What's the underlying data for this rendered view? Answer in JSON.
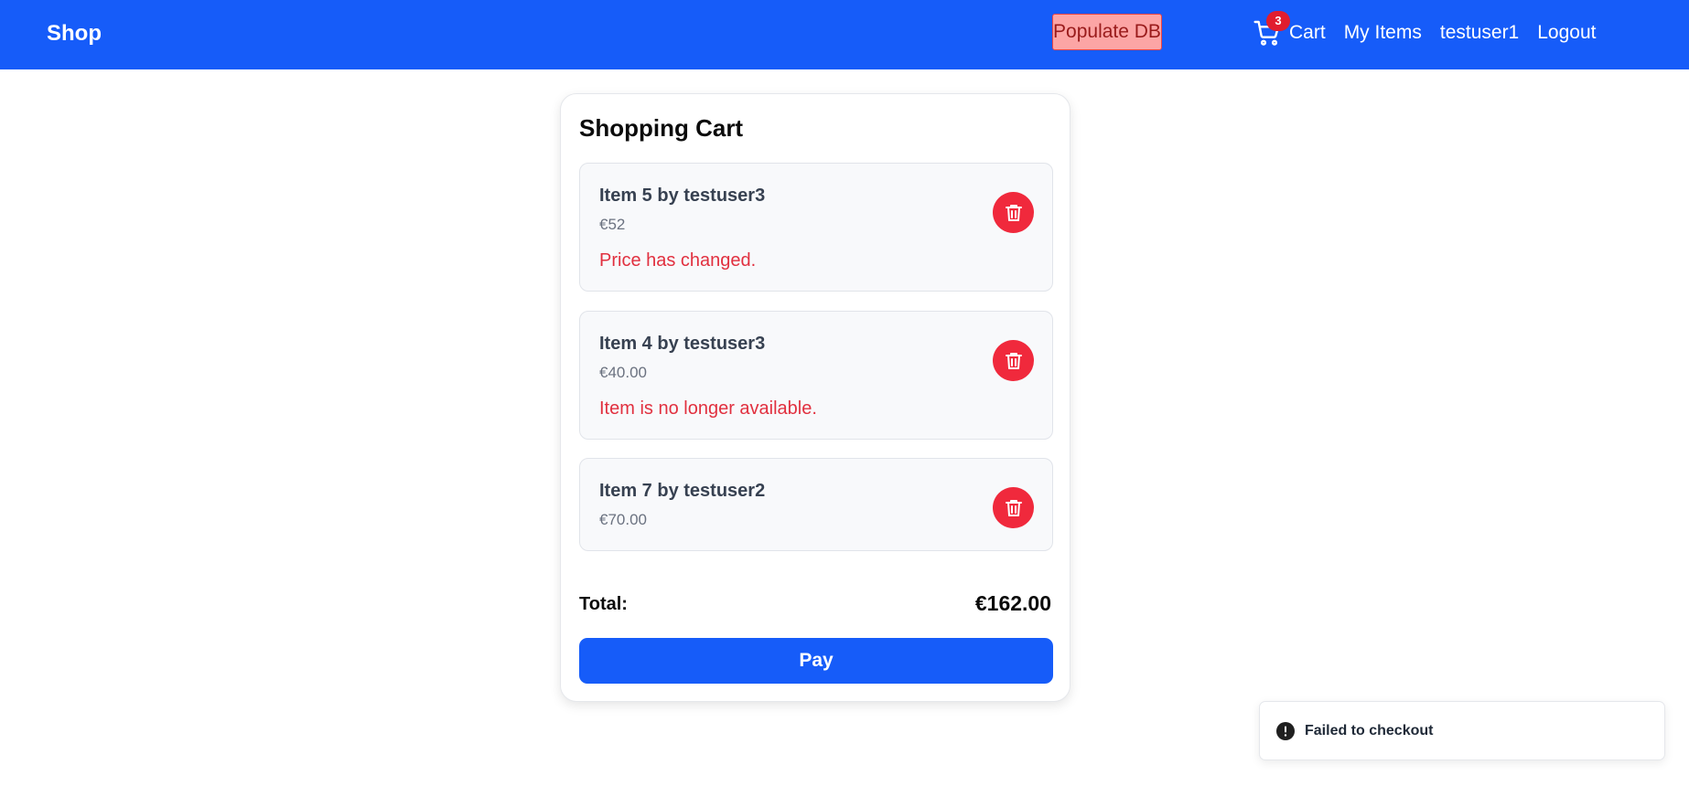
{
  "navbar": {
    "brand": "Shop",
    "populate_label": "Populate DB",
    "cart_count": "3",
    "cart_label": "Cart",
    "my_items_label": "My Items",
    "username": "testuser1",
    "logout_label": "Logout",
    "background": "#165cf9"
  },
  "cart": {
    "title": "Shopping Cart",
    "items": [
      {
        "name": "Item 5 by testuser3",
        "price": "€52",
        "error": "Price has changed."
      },
      {
        "name": "Item 4 by testuser3",
        "price": "€40.00",
        "error": "Item is no longer available."
      },
      {
        "name": "Item 7 by testuser2",
        "price": "€70.00"
      }
    ],
    "total_label": "Total:",
    "total_value": "€162.00",
    "pay_label": "Pay"
  },
  "toast": {
    "message": "Failed to checkout",
    "icon": "error-circle-icon"
  },
  "colors": {
    "accent": "#165cf9",
    "danger": "#f0293c",
    "error_text": "#e1303f"
  }
}
